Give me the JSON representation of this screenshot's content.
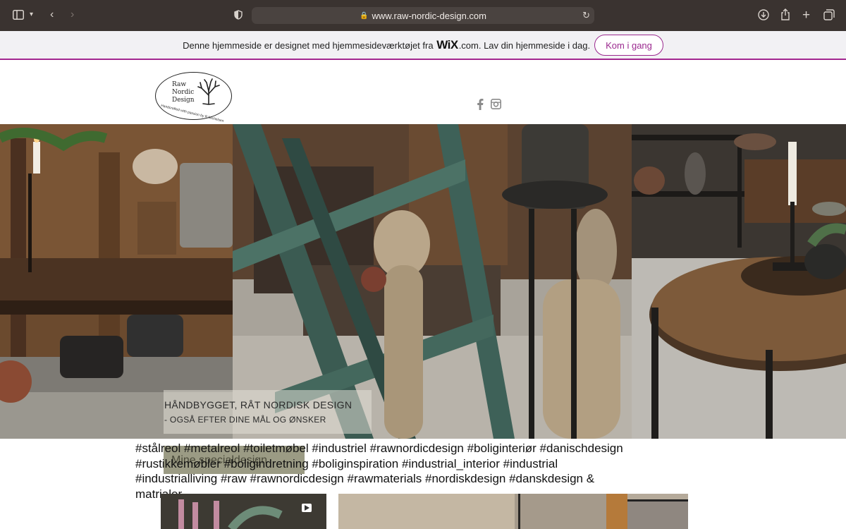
{
  "browser": {
    "url": "www.raw-nordic-design.com",
    "icons": [
      "sidebar-icon",
      "chevron-down-icon",
      "back-icon",
      "forward-icon",
      "shield-icon",
      "lock-icon",
      "reload-icon",
      "download-icon",
      "share-icon",
      "new-tab-icon",
      "tabs-icon"
    ]
  },
  "wix_banner": {
    "text_before": "Denne hjemmeside er designet med hjemmesideværktøjet fra",
    "logo": "WiX",
    "text_after": ".com. Lav din hjemmeside i dag.",
    "cta": "Kom i gang",
    "accent": "#9b2a8f"
  },
  "header": {
    "logo_line1": "Raw",
    "logo_line2": "Nordic",
    "logo_line3": "Design",
    "logo_tagline": "Handcrafted with passion by R.Michelsen",
    "social": [
      "facebook-icon",
      "instagram-icon"
    ]
  },
  "hero": {
    "title": "HÅNDBYGGET, RÅT NORDISK DESIGN",
    "subtitle": "- OGSÅ EFTER DINE MÅL OG ØNSKER",
    "cta": "Mine specialdesign"
  },
  "hashtags": {
    "line1": "#stålreol #metalreol #toiletmøbel #industriel #rawnordicdesign #boliginteriør #danischdesign",
    "line2": "#rustikkemøbler #boligindretning #boliginspiration #industrial_interior #industrial",
    "line3": "#industrialliving #raw #rawnordicdesign #rawmaterials #nordiskdesign #danskdesign &",
    "line4": "matrialer"
  }
}
